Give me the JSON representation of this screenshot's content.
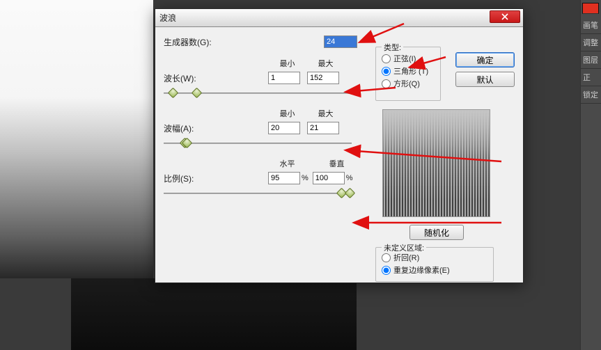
{
  "dialog": {
    "title": "波浪"
  },
  "generators": {
    "label": "生成器数(G):",
    "value": "24"
  },
  "wavelength": {
    "label": "波长(W):",
    "min_label": "最小",
    "max_label": "最大",
    "min": "1",
    "max": "152"
  },
  "amplitude": {
    "label": "波幅(A):",
    "min_label": "最小",
    "max_label": "最大",
    "min": "20",
    "max": "21"
  },
  "scale": {
    "label": "比例(S):",
    "horiz_label": "水平",
    "vert_label": "垂直",
    "horiz": "95",
    "vert": "100",
    "unit": "%"
  },
  "type_group": {
    "title": "类型:",
    "opt_sine": "正弦(I)",
    "opt_triangle": "三角形 (T)",
    "opt_square": "方形(Q)",
    "selected": "triangle"
  },
  "undefined_group": {
    "title": "未定义区域:",
    "opt_wrap": "折回(R)",
    "opt_repeat": "重复边缘像素(E)",
    "selected": "repeat"
  },
  "buttons": {
    "ok": "确定",
    "cancel": "默认",
    "randomize": "随机化"
  },
  "side_panel": {
    "items": [
      "画笔",
      "调整",
      "图层",
      "正",
      "锁定"
    ]
  }
}
